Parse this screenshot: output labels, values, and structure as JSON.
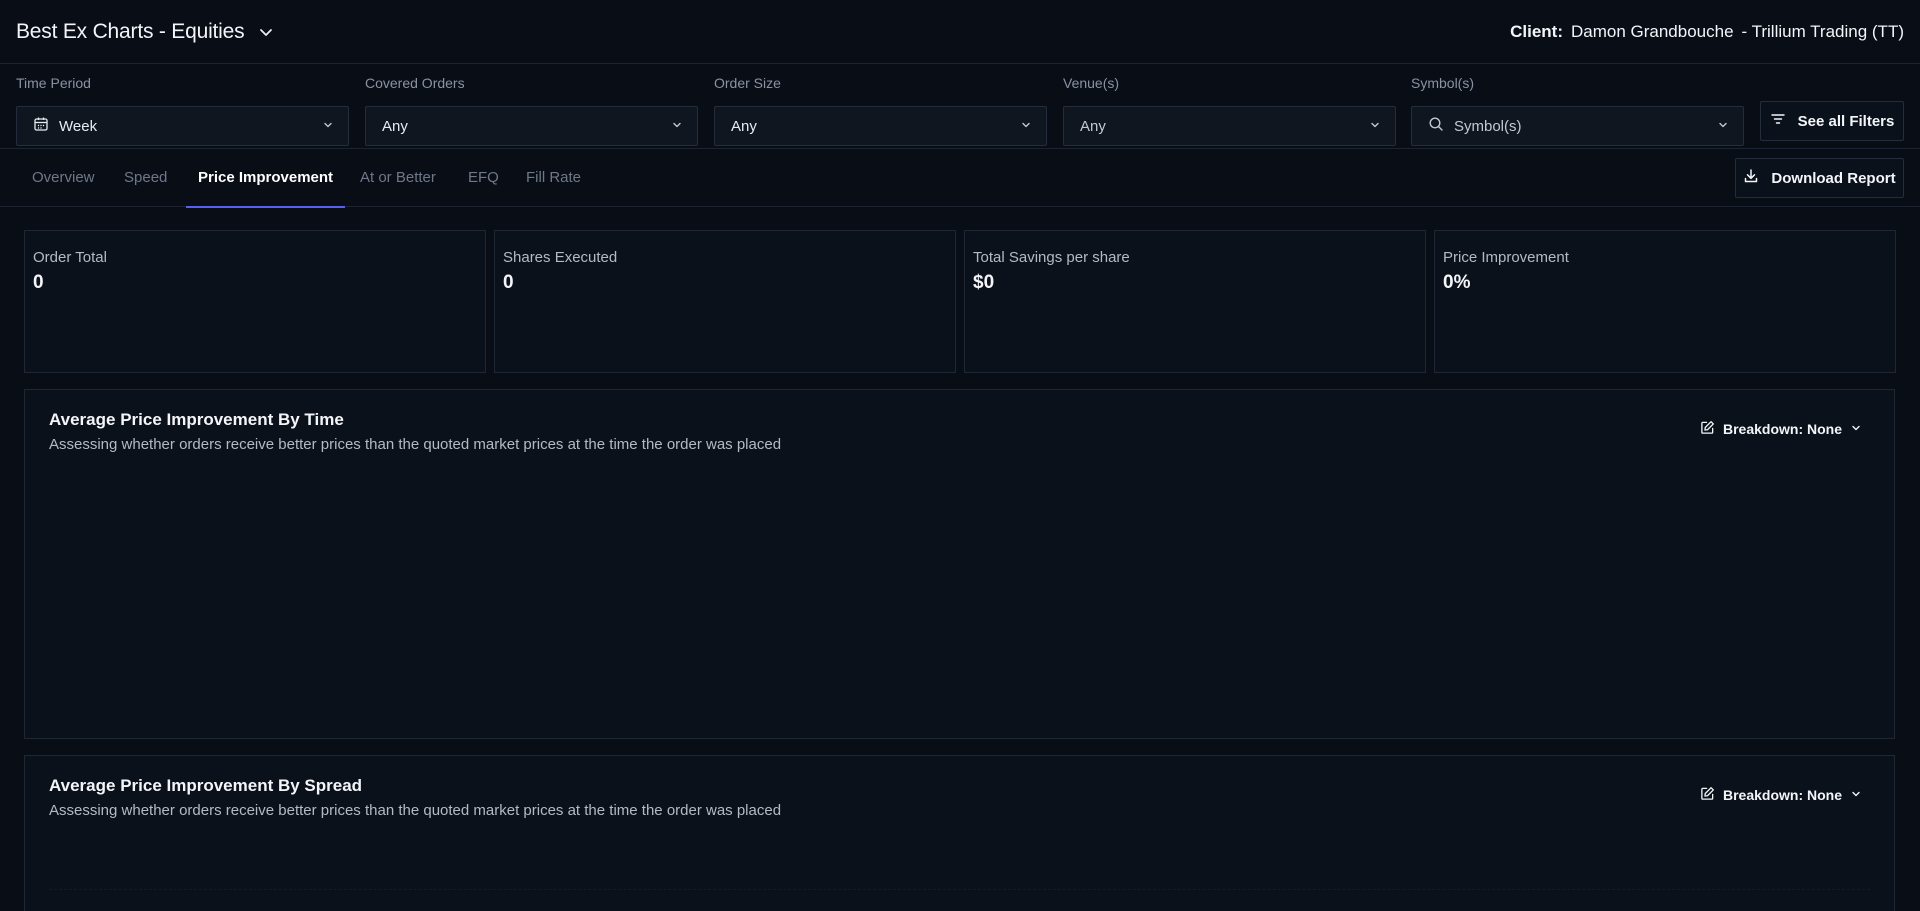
{
  "header": {
    "title": "Best Ex Charts - Equities",
    "client_label": "Client:",
    "client_name": "Damon Grandbouche",
    "client_firm": "- Trillium Trading (TT)"
  },
  "filters": {
    "time_period": {
      "label": "Time Period",
      "value": "Week"
    },
    "covered_orders": {
      "label": "Covered Orders",
      "value": "Any"
    },
    "order_size": {
      "label": "Order Size",
      "value": "Any"
    },
    "venues": {
      "label": "Venue(s)",
      "value": "Any"
    },
    "symbols": {
      "label": "Symbol(s)",
      "placeholder": "Symbol(s)"
    },
    "see_all": "See all Filters"
  },
  "tabs": [
    "Overview",
    "Speed",
    "Price Improvement",
    "At or Better",
    "EFQ",
    "Fill Rate"
  ],
  "active_tab": "Price Improvement",
  "download_label": "Download Report",
  "stats": [
    {
      "label": "Order Total",
      "value": "0"
    },
    {
      "label": "Shares Executed",
      "value": "0"
    },
    {
      "label": "Total Savings per share",
      "value": "$0"
    },
    {
      "label": "Price Improvement",
      "value": "0%"
    }
  ],
  "panels": [
    {
      "title": "Average Price Improvement By Time",
      "subtitle": "Assessing whether orders receive better prices than the quoted market prices at the time the order was placed",
      "breakdown": "Breakdown: None"
    },
    {
      "title": "Average Price Improvement By Spread",
      "subtitle": "Assessing whether orders receive better prices than the quoted market prices at the time the order was placed",
      "breakdown": "Breakdown: None"
    }
  ],
  "colors": {
    "background": "#080d16",
    "panel": "#0b111b",
    "accent": "#5b5ff0",
    "border": "#1f2734"
  }
}
